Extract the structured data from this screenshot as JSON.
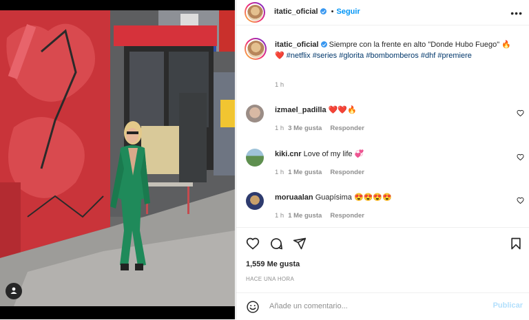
{
  "post": {
    "username": "itatic_oficial",
    "follow_label": "Seguir",
    "caption_text": "Siempre con la frente en alto \"Donde Hubo Fuego\" 🔥❤️",
    "hashtags": [
      "#netflix",
      "#series",
      "#glorita",
      "#bombomberos",
      "#dhf",
      "#premiere"
    ],
    "caption_time": "1 h",
    "likes": "1,559 Me gusta",
    "posted_ago": "HACE UNA HORA"
  },
  "comments": [
    {
      "username": "izmael_padilla",
      "text": "❤️❤️🔥",
      "time": "1 h",
      "likes": "3 Me gusta",
      "reply": "Responder"
    },
    {
      "username": "kiki.cnr",
      "text": "Love of my life 💞",
      "time": "1 h",
      "likes": "1 Me gusta",
      "reply": "Responder"
    },
    {
      "username": "moruaalan",
      "text": "Guapísima 😍😍😍😍",
      "time": "1 h",
      "likes": "1 Me gusta",
      "reply": "Responder"
    }
  ],
  "add_comment": {
    "placeholder": "Añade un comentario...",
    "publish_label": "Publicar"
  },
  "icons": {
    "like": "heart-icon",
    "comment": "comment-icon",
    "share": "send-icon",
    "save": "bookmark-icon",
    "emoji": "emoji-icon",
    "more": "more-options-icon",
    "tag": "user-tag-icon"
  },
  "colors": {
    "link": "#00376b",
    "follow": "#0095f6",
    "verified": "#3897f0",
    "publish_disabled": "#b2dffc"
  }
}
